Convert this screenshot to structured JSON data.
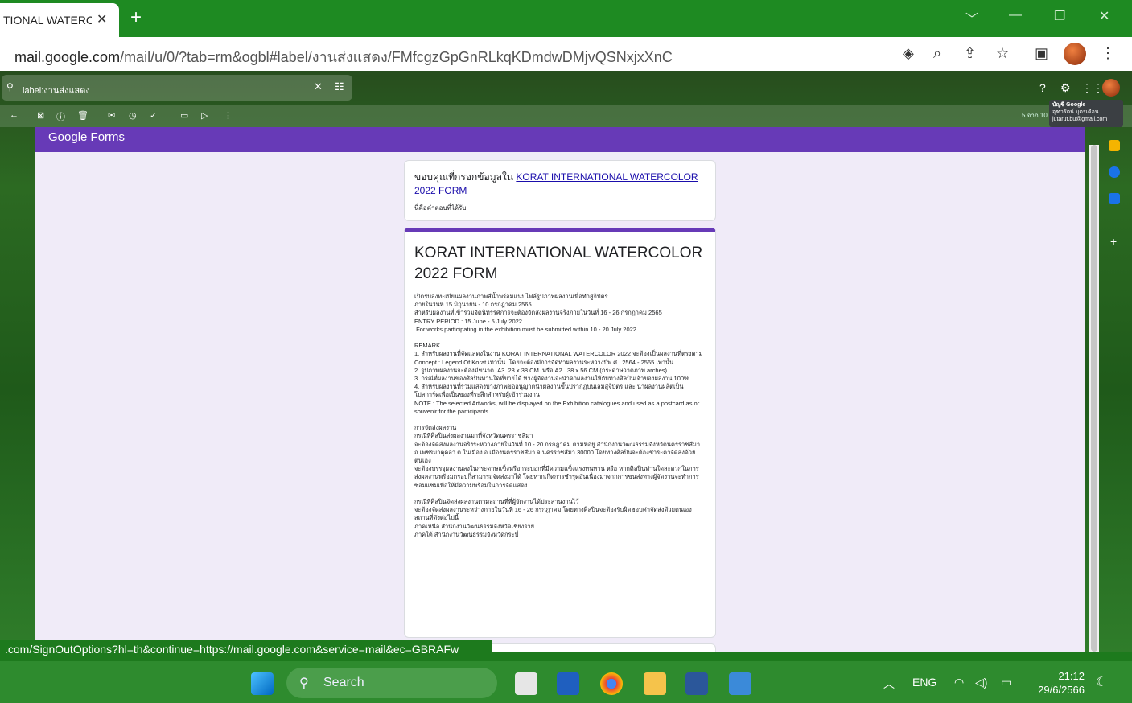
{
  "browser": {
    "tab_title": "TIONAL WATERC",
    "tab_close": "✕",
    "new_tab": "+",
    "url_host": "mail.google.com",
    "url_path": "/mail/u/0/?tab=rm&ogbl#label/งานส่งแสดง/FMfcgzGpGnRLkqKDmdwDMjvQSNxjxXnC"
  },
  "gmail": {
    "search_text": "label:งานส่งแสดง",
    "page_count": "5 จาก 10",
    "account_tip": {
      "name": "บัญชี Google",
      "person": "จุฑารัตน์ บุตรเดือน",
      "email": "jutarut.bu@gmail.com"
    }
  },
  "email": {
    "forms_logo": "Google Forms",
    "thanks_prefix": "ขอบคุณที่กรอกข้อมูลใน ",
    "thanks_link": "KORAT INTERNATIONAL WATERCOLOR 2022  FORM",
    "thanks_sub": "นี่คือคำตอบที่ได้รับ",
    "form_title": "KORAT INTERNATIONAL WATERCOLOR 2022  FORM",
    "description": "เปิดรับลงทะเบียนผลงานภาพสีน้ำพร้อมแนบไฟล์รูปภาพผลงานเพื่อทำสูจิบัตร\nภายในวันที่ 15 มิถุนายน - 10 กรกฎาคม 2565\nสำหรับผลงานที่เข้าร่วมจัดนิทรรศการจะต้องจัดส่งผลงานจริงภายในวันที่ 16 - 26 กรกฎาคม 2565\nENTRY PERIOD : 15 June - 5 July 2022\n For works participating in the exhibition must be submitted within 10 - 20 July 2022.\n\nREMARK\n1. สำหรับผลงานที่จัดแสดงในงาน KORAT INTERNATIONAL WATERCOLOR 2022 จะต้องเป็นผลงานที่ตรงตาม Concept : Legend Of Korat เท่านั้น  โดยจะต้องมีการจัดทำผลงานระหว่างปีพ.ศ.  2564 - 2565 เท่านั้น\n2. รูปภาพผลงานจะต้องมีขนาด  A3  28 x 38 CM  หรือ A2   38 x 56 CM (กระดาษวาดภาพ arches)\n3. กรณีที่ผลงานของศิลปินท่านใดที่ขายได้ ทางผู้จัดงานจะนำค่าผลงานให้กับทางศิลปินเจ้าของผลงาน 100%\n4. สำหรับผลงานที่ร่วมแสดงบางภาพขออนุญาตนำผลงานขึ้นปรากฏบนเล่มสูจิบัตร และ นำผลงานผลิตเป็นโปสการ์ดเพื่อเป็นของที่ระลึกสำหรับผู้เข้าร่วมงาน\nNOTE : The selected Artworks, will be displayed on the Exhibition catalogues and used as a postcard as or souvenir for the participants.\n\nการจัดส่งผลงาน\nกรณีที่ศิลปินส่งผลงานมาที่จังหวัดนครราชสีมา\nจะต้องจัดส่งผลงานจริงระหว่างภายในวันที่ 10 - 20 กรกฎาคม ตามที่อยู่ สำนักงานวัฒนธรรมจังหวัดนครราชสีมา ถ.เพชรมาตุคลา ต.ในเมือง อ.เมืองนครราชสีมา จ.นครราชสีมา 30000 โดยทางศิลปินจะต้องชำระค่าจัดส่งด้วยตนเอง\nจะต้องบรรจุผลงานลงในกระดาษแข็งหรือกระบอกที่มีความแข็งแรงทนทาน หรือ หากศิลปินท่านใดสะดวกในการส่งผลงานพร้อมกรอบก็สามารถจัดส่งมาได้ โดยหากเกิดการชำรุดอันเนื่องมาจากการขนส่งทางผู้จัดงานจะทำการซ่อมแซมเพื่อให้มีความพร้อมในการจัดแสดง\n\nกรณีที่ศิลปินจัดส่งผลงานตามสถานที่ที่ผู้จัดงานได้ประสานงานไว้\nจะต้องจัดส่งผลงานระหว่างภายในวันที่ 16 - 26 กรกฎาคม โดยทางศิลปินจะต้องรับผิดชอบค่าจัดส่งด้วยตนเอง\nสถานที่ดังต่อไปนี้\nภาคเหนือ สำนักงานวัฒนธรรมจังหวัดเชียงราย\nภาคใต้ สำนักงานวัฒนธรรมจังหวัดกระบี่"
  },
  "status_url": ".com/SignOutOptions?hl=th&continue=https://mail.google.com&service=mail&ec=GBRAFw",
  "taskbar": {
    "search_label": "Search",
    "lang": "ENG",
    "time": "21:12",
    "date": "29/6/2566"
  },
  "colors": {
    "forms_purple": "#673ab7",
    "chrome_green": "#1e8a22"
  }
}
